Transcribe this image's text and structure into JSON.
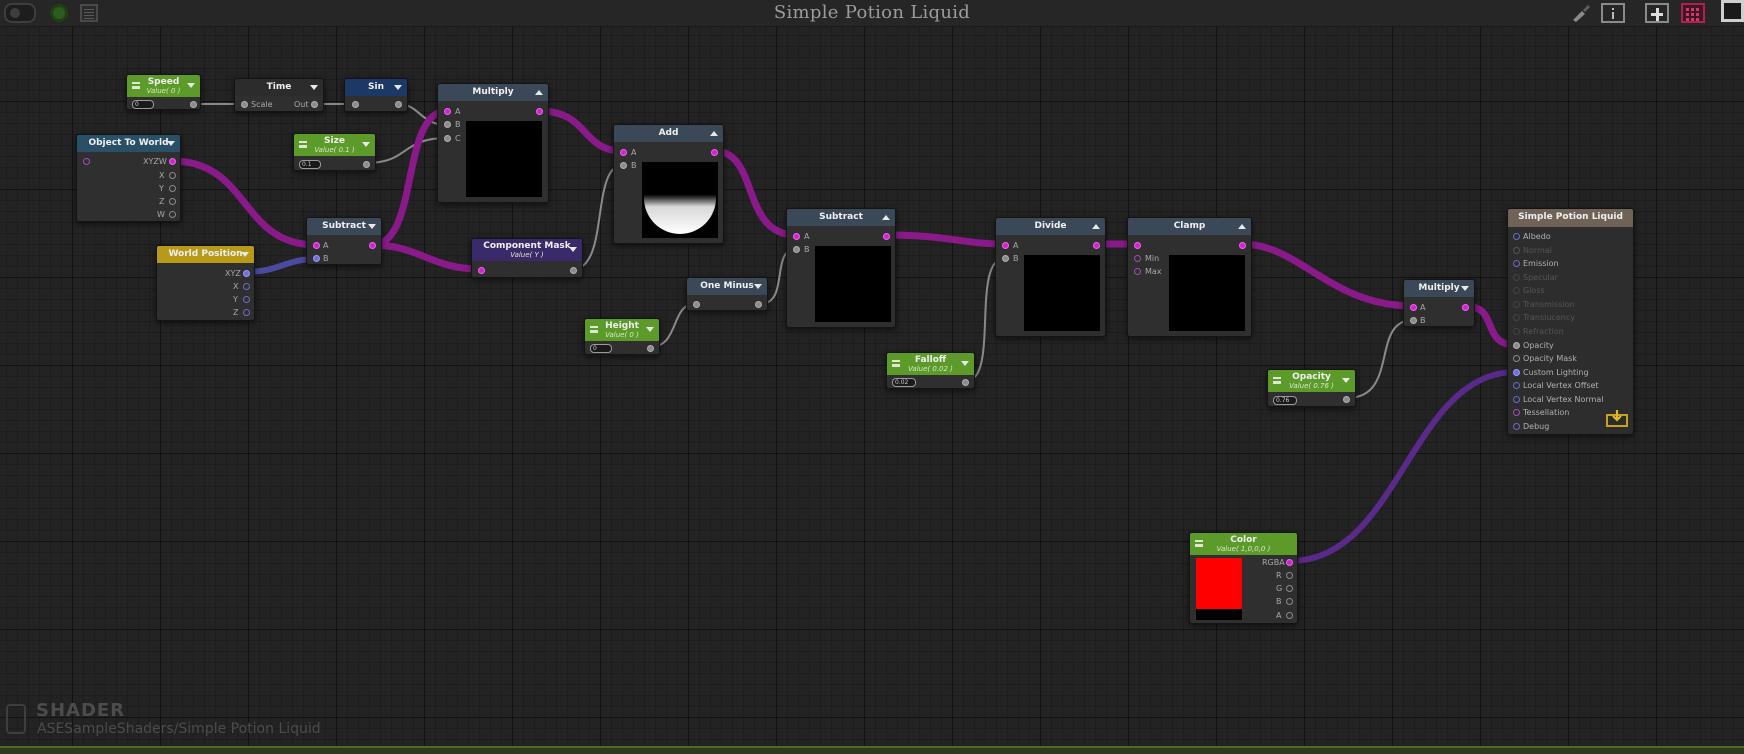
{
  "window": {
    "title": "Simple Potion Liquid"
  },
  "toolbar": {
    "left_icons": [
      "toggle-icon",
      "live-mode-icon",
      "calendar-icon"
    ],
    "right_icons": [
      "clean-brush-icon",
      "info-icon",
      "add-icon",
      "grid-share-icon",
      "maximize-icon"
    ]
  },
  "nodes": {
    "speed": {
      "title": "Speed",
      "sub": "Value( 0 )",
      "field": "0"
    },
    "time": {
      "title": "Time",
      "in": "Scale",
      "out": "Out"
    },
    "sin": {
      "title": "Sin"
    },
    "multiply1": {
      "title": "Multiply",
      "ports": [
        "A",
        "B",
        "C"
      ]
    },
    "object_to_world": {
      "title": "Object To World",
      "ports": [
        "XYZW",
        "X",
        "Y",
        "Z",
        "W"
      ]
    },
    "size": {
      "title": "Size",
      "sub": "Value( 0.1 )",
      "field": "0.1"
    },
    "world_position": {
      "title": "World Position",
      "ports": [
        "XYZ",
        "X",
        "Y",
        "Z"
      ]
    },
    "subtract1": {
      "title": "Subtract",
      "ports": [
        "A",
        "B"
      ]
    },
    "component_mask": {
      "title": "Component Mask",
      "sub": "Value( Y )"
    },
    "add": {
      "title": "Add",
      "ports": [
        "A",
        "B"
      ]
    },
    "height": {
      "title": "Height",
      "sub": "Value( 0 )",
      "field": "0"
    },
    "one_minus": {
      "title": "One Minus"
    },
    "subtract2": {
      "title": "Subtract",
      "ports": [
        "A",
        "B"
      ]
    },
    "divide": {
      "title": "Divide",
      "ports": [
        "A",
        "B"
      ]
    },
    "clamp": {
      "title": "Clamp",
      "ports": [
        "Min",
        "Max"
      ]
    },
    "falloff": {
      "title": "Falloff",
      "sub": "Value( 0.02 )",
      "field": "0.02"
    },
    "multiply2": {
      "title": "Multiply",
      "ports": [
        "A",
        "B"
      ]
    },
    "opacity": {
      "title": "Opacity",
      "sub": "Value( 0.76 )",
      "field": "0.76"
    },
    "color": {
      "title": "Color",
      "sub": "Value( 1,0,0,0 )",
      "ports": [
        "RGBA",
        "R",
        "G",
        "B",
        "A"
      ],
      "swatch": "#ff0000"
    },
    "output": {
      "title": "Simple Potion Liquid",
      "ports": [
        "Albedo",
        "Normal",
        "Emission",
        "Specular",
        "Gloss",
        "Transmission",
        "Translucency",
        "Refraction",
        "Opacity",
        "Opacity Mask",
        "Custom Lighting",
        "Local Vertex Offset",
        "Local Vertex Normal",
        "Tessellation",
        "Debug"
      ]
    }
  },
  "footer": {
    "label": "SHADER",
    "path": "ASESampleShaders/Simple Potion Liquid"
  },
  "colors": {
    "wire_pink": "#8a1a8a",
    "wire_blue": "#4a4aa0",
    "header_green": "#5a8f2a",
    "header_gray": "#2a2a2a",
    "header_slate": "#3a4858",
    "header_navy": "#1c3660",
    "header_teal": "#2a5068",
    "header_yellow": "#b89a1a",
    "header_purple": "#3a2a6a",
    "header_output": "#6f6358"
  }
}
